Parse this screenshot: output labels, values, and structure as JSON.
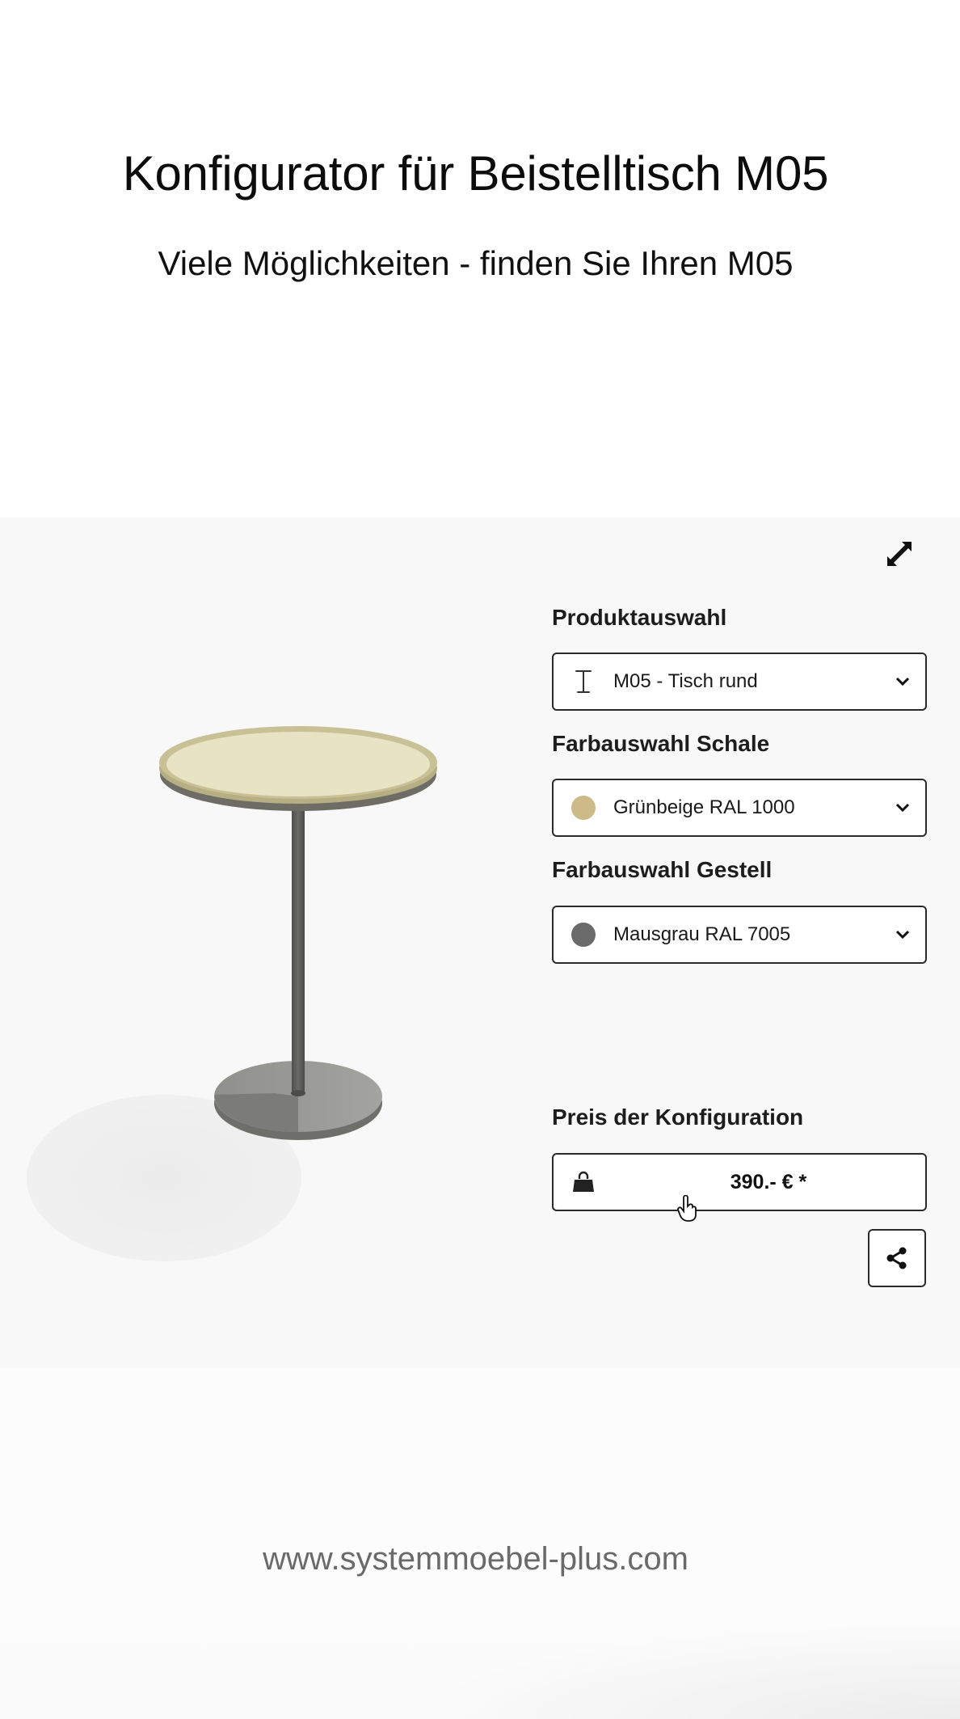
{
  "header": {
    "title": "Konfigurator für Beistelltisch M05",
    "subtitle": "Viele Möglichkeiten - finden Sie Ihren M05"
  },
  "configurator": {
    "product": {
      "label": "Produktauswahl",
      "icon": "table-pillar-icon",
      "value": "M05 - Tisch rund"
    },
    "shell_color": {
      "label": "Farbauswahl Schale",
      "value": "Grünbeige RAL 1000",
      "swatch": "#ccbb89"
    },
    "frame_color": {
      "label": "Farbauswahl Gestell",
      "value": "Mausgrau RAL 7005",
      "swatch": "#6b6b6b"
    },
    "price": {
      "label": "Preis der Konfiguration",
      "value": "390.- € *",
      "icon": "shopping-bag-icon"
    },
    "share_icon": "share-icon",
    "expand_icon": "expand-icon"
  },
  "footer": {
    "url": "www.systemmoebel-plus.com"
  },
  "colors": {
    "tabletop": "#e6e0bf",
    "tabletop_rim": "#b3ab7f",
    "frame": "#5f605c",
    "base": "#9a9b97"
  }
}
